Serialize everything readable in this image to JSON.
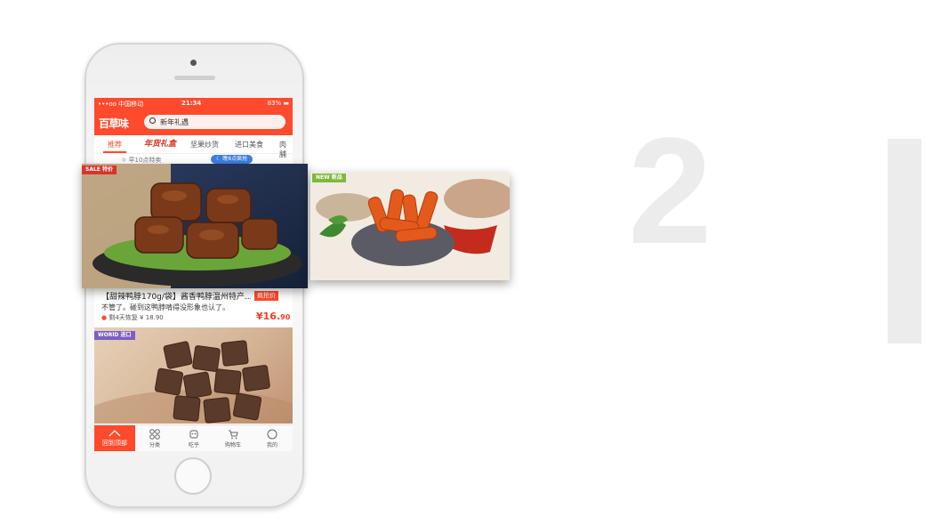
{
  "status_bar": {
    "carrier": "•••oo 中国移动",
    "time": "21:34",
    "battery": "83%"
  },
  "header": {
    "logo": "百草味",
    "search_placeholder": "新年礼遇"
  },
  "tabs": [
    {
      "label": "推荐"
    },
    {
      "label": "年货礼盒"
    },
    {
      "label": "坚果炒货"
    },
    {
      "label": "进口美食"
    },
    {
      "label": "肉脯"
    }
  ],
  "notice": {
    "left": "早10点特卖",
    "right": "晚8点疯抢"
  },
  "featured_card": {
    "tag_en": "SALE",
    "tag_cn": "特价",
    "tag_color": "#d9342b"
  },
  "side_card": {
    "tag_en": "NEW",
    "tag_cn": "新品",
    "tag_color": "#7fb83a"
  },
  "product": {
    "title": "【甜辣鸭脖170g/袋】酱香鸭脖温州特产...",
    "desc": "不管了。碰到这鸭脖啃得没形象也认了。",
    "stock": "剩4天恢复 ¥ 18.90",
    "badge": "疯抢价",
    "price_main": "¥16.",
    "price_cents": "90"
  },
  "wafer_card": {
    "tag_en": "WORlD",
    "tag_cn": "进口",
    "tag_color": "#7b5fc4"
  },
  "bottom_nav": {
    "back_top": "回到顶部",
    "items": [
      {
        "label": "分类"
      },
      {
        "label": "吃乎"
      },
      {
        "label": "购物车"
      },
      {
        "label": "我的"
      }
    ]
  },
  "decor": {
    "big_number": "2"
  }
}
